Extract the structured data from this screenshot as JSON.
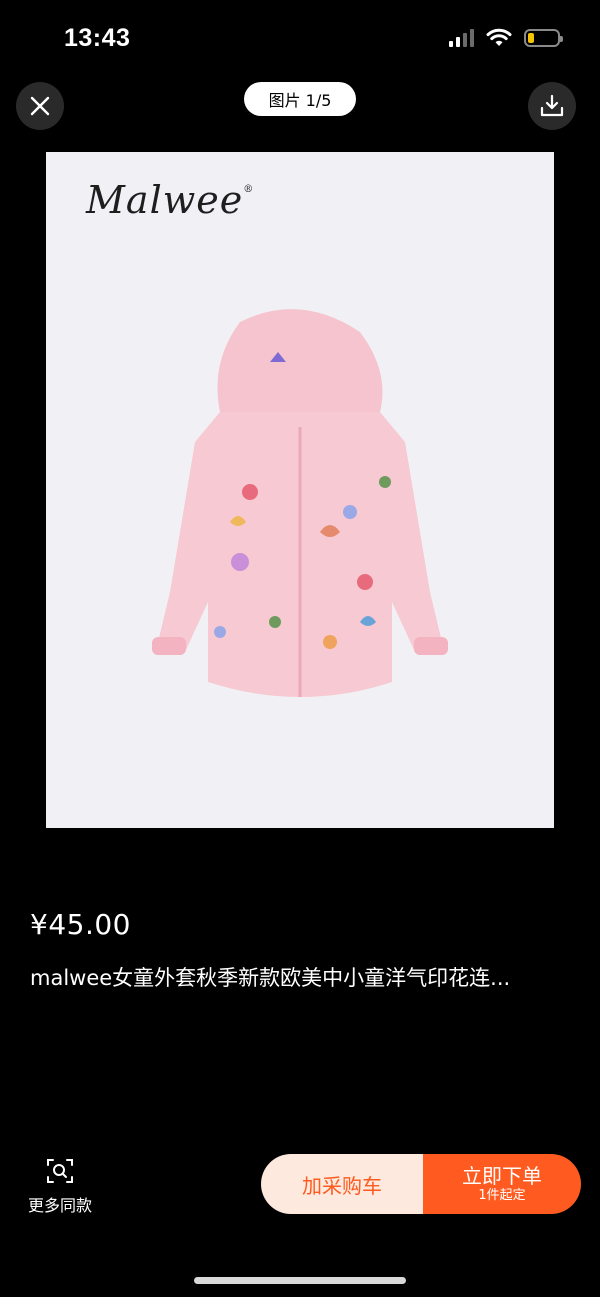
{
  "status_bar": {
    "time": "13:43",
    "battery_level": 0.2,
    "icons": [
      "cellular-signal-icon",
      "wifi-icon",
      "battery-icon"
    ]
  },
  "viewer": {
    "counter": "图片 1/5",
    "close_icon": "close-icon",
    "download_icon": "download-icon"
  },
  "product_image": {
    "brand_logo": "Malwee",
    "brand_mark": "®"
  },
  "product": {
    "price": "¥45.00",
    "title": "malwee女童外套秋季新款欧美中小童洋气印花连..."
  },
  "actions": {
    "similar_label": "更多同款",
    "similar_icon": "image-search-icon",
    "cart_label": "加采购车",
    "buy_label": "立即下单",
    "buy_sub": "1件起定"
  },
  "colors": {
    "background": "#000000",
    "accent": "#ff5a1f",
    "cart_bg": "#fde9dd",
    "battery": "#f5c400",
    "jacket": "#f7c9d2"
  }
}
